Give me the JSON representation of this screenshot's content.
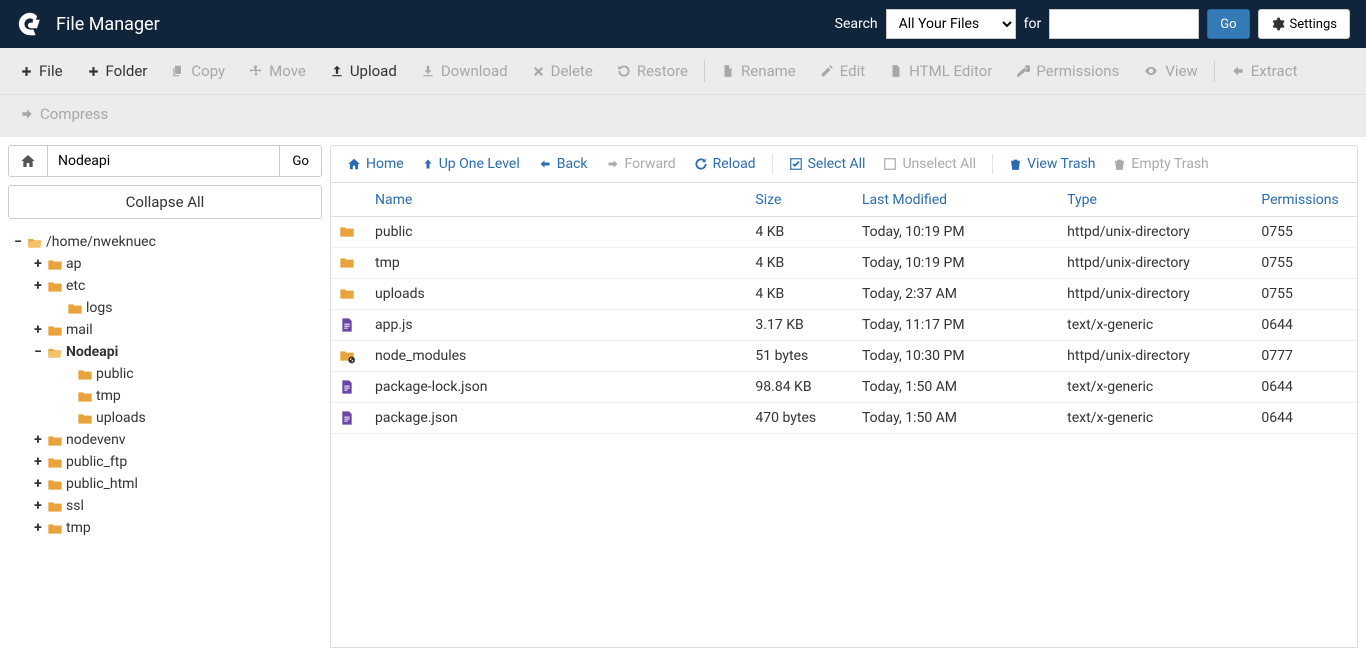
{
  "header": {
    "title": "File Manager",
    "search_label": "Search",
    "search_scope": "All Your Files",
    "for_label": "for",
    "search_value": "",
    "go_label": "Go",
    "settings_label": "Settings"
  },
  "toolbar": {
    "file": "File",
    "folder": "Folder",
    "copy": "Copy",
    "move": "Move",
    "upload": "Upload",
    "download": "Download",
    "delete": "Delete",
    "restore": "Restore",
    "rename": "Rename",
    "edit": "Edit",
    "html_editor": "HTML Editor",
    "permissions": "Permissions",
    "view": "View",
    "extract": "Extract",
    "compress": "Compress"
  },
  "pathbar": {
    "path": "Nodeapi",
    "go": "Go",
    "collapse_all": "Collapse All"
  },
  "tree": [
    {
      "depth": 0,
      "toggle": "−",
      "icon": "folder-open",
      "label": "/home/nweknuec",
      "bold": false
    },
    {
      "depth": 1,
      "toggle": "+",
      "icon": "folder",
      "label": "ap",
      "bold": false
    },
    {
      "depth": 1,
      "toggle": "+",
      "icon": "folder",
      "label": "etc",
      "bold": false
    },
    {
      "depth": 2,
      "toggle": "",
      "icon": "folder",
      "label": "logs",
      "bold": false
    },
    {
      "depth": 1,
      "toggle": "+",
      "icon": "folder",
      "label": "mail",
      "bold": false
    },
    {
      "depth": 1,
      "toggle": "−",
      "icon": "folder-open",
      "label": "Nodeapi",
      "bold": true
    },
    {
      "depth": 3,
      "toggle": "",
      "icon": "folder",
      "label": "public",
      "bold": false
    },
    {
      "depth": 3,
      "toggle": "",
      "icon": "folder",
      "label": "tmp",
      "bold": false
    },
    {
      "depth": 3,
      "toggle": "",
      "icon": "folder",
      "label": "uploads",
      "bold": false
    },
    {
      "depth": 1,
      "toggle": "+",
      "icon": "folder",
      "label": "nodevenv",
      "bold": false
    },
    {
      "depth": 1,
      "toggle": "+",
      "icon": "folder",
      "label": "public_ftp",
      "bold": false
    },
    {
      "depth": 1,
      "toggle": "+",
      "icon": "folder",
      "label": "public_html",
      "bold": false
    },
    {
      "depth": 1,
      "toggle": "+",
      "icon": "folder",
      "label": "ssl",
      "bold": false
    },
    {
      "depth": 1,
      "toggle": "+",
      "icon": "folder",
      "label": "tmp",
      "bold": false
    }
  ],
  "fm_toolbar": {
    "home": "Home",
    "up_one": "Up One Level",
    "back": "Back",
    "forward": "Forward",
    "reload": "Reload",
    "select_all": "Select All",
    "unselect_all": "Unselect All",
    "view_trash": "View Trash",
    "empty_trash": "Empty Trash"
  },
  "table": {
    "headers": {
      "name": "Name",
      "size": "Size",
      "modified": "Last Modified",
      "type": "Type",
      "permissions": "Permissions"
    },
    "rows": [
      {
        "icon": "folder",
        "name": "public",
        "size": "4 KB",
        "modified": "Today, 10:19 PM",
        "type": "httpd/unix-directory",
        "permissions": "0755"
      },
      {
        "icon": "folder",
        "name": "tmp",
        "size": "4 KB",
        "modified": "Today, 10:19 PM",
        "type": "httpd/unix-directory",
        "permissions": "0755"
      },
      {
        "icon": "folder",
        "name": "uploads",
        "size": "4 KB",
        "modified": "Today, 2:37 AM",
        "type": "httpd/unix-directory",
        "permissions": "0755"
      },
      {
        "icon": "file",
        "name": "app.js",
        "size": "3.17 KB",
        "modified": "Today, 11:17 PM",
        "type": "text/x-generic",
        "permissions": "0644"
      },
      {
        "icon": "folder-link",
        "name": "node_modules",
        "size": "51 bytes",
        "modified": "Today, 10:30 PM",
        "type": "httpd/unix-directory",
        "permissions": "0777"
      },
      {
        "icon": "file",
        "name": "package-lock.json",
        "size": "98.84 KB",
        "modified": "Today, 1:50 AM",
        "type": "text/x-generic",
        "permissions": "0644"
      },
      {
        "icon": "file",
        "name": "package.json",
        "size": "470 bytes",
        "modified": "Today, 1:50 AM",
        "type": "text/x-generic",
        "permissions": "0644"
      }
    ]
  }
}
